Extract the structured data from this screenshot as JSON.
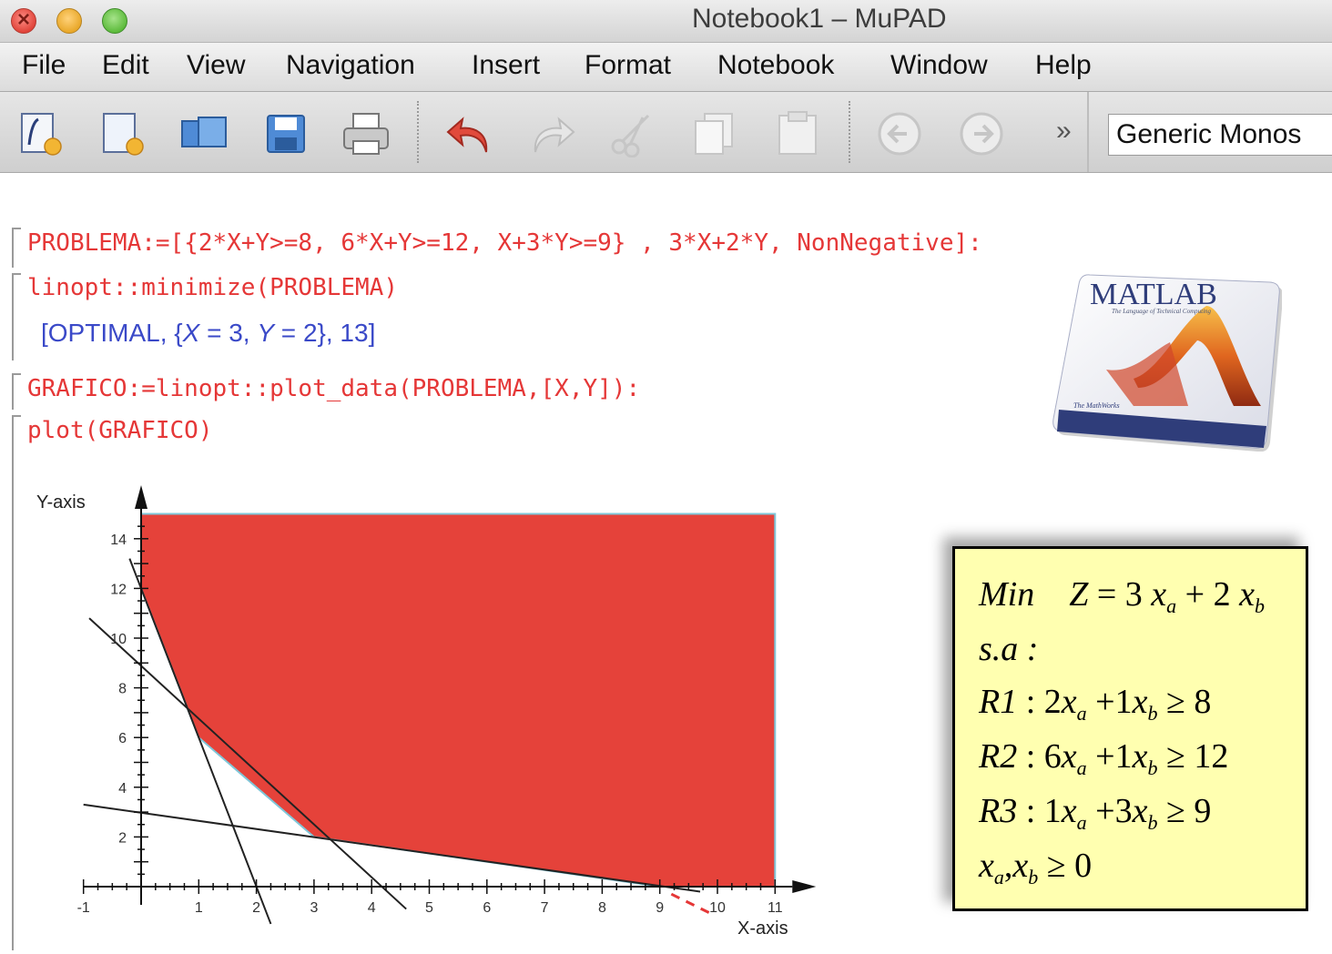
{
  "window": {
    "title": "Notebook1 – MuPAD"
  },
  "menu": [
    "File",
    "Edit",
    "View",
    "Navigation",
    "Insert",
    "Format",
    "Notebook",
    "Window",
    "Help"
  ],
  "toolbar": {
    "icons": [
      "new-notebook-icon",
      "new-editor-icon",
      "open-icon",
      "save-icon",
      "print-icon",
      "undo-icon",
      "redo-icon",
      "cut-icon",
      "copy-icon",
      "paste-icon",
      "back-icon",
      "forward-icon",
      "overflow-icon"
    ],
    "overflow": "»",
    "font_name": "Generic Monos"
  },
  "notebook": {
    "input1": "PROBLEMA:=[{2*X+Y>=8, 6*X+Y>=12, X+3*Y>=9} , 3*X+2*Y, NonNegative]:",
    "input2": "linopt::minimize(PROBLEMA)",
    "output2": {
      "open": "[OPTIMAL, {",
      "x_var": "X",
      "x_eq": " = 3, ",
      "y_var": "Y",
      "y_eq": " = 2}, 13]"
    },
    "input3": "GRAFICO:=linopt::plot_data(PROBLEMA,[X,Y]):",
    "input4": "plot(GRAFICO)"
  },
  "matlab_logo": {
    "brand": "MATLAB",
    "tagline": "The Language of Technical Computing",
    "maker": "The MathWorks"
  },
  "chart_data": {
    "type": "area",
    "xlabel": "X-axis",
    "ylabel": "Y-axis",
    "xlim": [
      -1,
      11
    ],
    "ylim": [
      0,
      15
    ],
    "x_ticks": [
      -1,
      1,
      2,
      3,
      4,
      5,
      6,
      7,
      8,
      9,
      10,
      11
    ],
    "y_ticks": [
      2,
      4,
      6,
      8,
      10,
      12,
      14
    ],
    "feasible_region": {
      "color": "#e5423a",
      "vertices": [
        [
          0,
          15
        ],
        [
          11,
          15
        ],
        [
          11,
          0
        ],
        [
          9,
          0
        ],
        [
          3,
          2
        ],
        [
          1,
          6
        ],
        [
          0,
          12
        ]
      ]
    },
    "constraint_lines": [
      {
        "points": [
          [
            -0.9,
            10.8
          ],
          [
            4.6,
            -0.9
          ]
        ]
      },
      {
        "points": [
          [
            -0.2,
            13.2
          ],
          [
            2.25,
            -1.5
          ]
        ]
      },
      {
        "points": [
          [
            -1,
            3.3
          ],
          [
            9.7,
            -0.2
          ]
        ]
      }
    ],
    "objective_line": {
      "color": "#e53737",
      "points": [
        [
          9.2,
          -0.3
        ],
        [
          9.9,
          -1.1
        ]
      ]
    }
  },
  "model": {
    "line1": {
      "min": "Min",
      "lhs": "Z",
      "eq": " = 3 ",
      "xa": "x",
      "sa": "a",
      "plus": " + 2 ",
      "xb": "x",
      "sb": "b"
    },
    "line2": "s.a :",
    "r1": {
      "label": "R1",
      "body1": " : 2",
      "x1": "x",
      "s1": "a",
      "body2": " +1",
      "x2": "x",
      "s2": "b",
      "rhs": " ≥ 8"
    },
    "r2": {
      "label": "R2",
      "body1": " : 6",
      "x1": "x",
      "s1": "a",
      "body2": " +1",
      "x2": "x",
      "s2": "b",
      "rhs": " ≥ 12"
    },
    "r3": {
      "label": "R3",
      "body1": " : 1",
      "x1": "x",
      "s1": "a",
      "body2": " +3",
      "x2": "x",
      "s2": "b",
      "rhs": " ≥ 9"
    },
    "nonneg": {
      "x1": "x",
      "s1": "a",
      "comma": ",",
      "x2": "x",
      "s2": "b",
      "rhs": " ≥ 0"
    }
  }
}
